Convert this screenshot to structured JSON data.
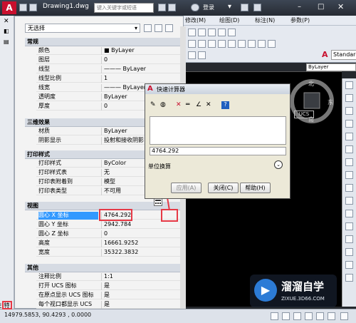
{
  "window": {
    "title": "Drawing1.dwg",
    "search_placeholder": "键入关键字或短语",
    "login": "登录"
  },
  "menu": [
    "修改(M)",
    "绘图(D)",
    "标注(N)",
    "参数(P)"
  ],
  "toolbar": {
    "style_value": "Standard",
    "layer_value": "ByLayer"
  },
  "viewcube": {
    "north": "北",
    "east": "东",
    "south": "南",
    "ucs": "UCS"
  },
  "statusbar": {
    "coords": "14979.5853,  90.4293  ,  0.0000"
  },
  "left_strip": {
    "label": "特性"
  },
  "palette": {
    "selection": "无选择",
    "sections": [
      {
        "title": "常规",
        "rows": [
          [
            "颜色",
            "■ ByLayer"
          ],
          [
            "图层",
            "0"
          ],
          [
            "线型",
            "——— ByLayer"
          ],
          [
            "线型比例",
            "1"
          ],
          [
            "线宽",
            "——— ByLayer"
          ],
          [
            "透明度",
            "ByLayer"
          ],
          [
            "厚度",
            "0"
          ]
        ]
      },
      {
        "title": "三维效果",
        "rows": [
          [
            "材质",
            "ByLayer"
          ],
          [
            "阴影显示",
            "投射和接收阴影"
          ]
        ]
      },
      {
        "title": "打印样式",
        "rows": [
          [
            "打印样式",
            "ByColor"
          ],
          [
            "打印样式表",
            "无"
          ],
          [
            "打印表附着到",
            "模型"
          ],
          [
            "打印表类型",
            "不可用"
          ]
        ]
      },
      {
        "title": "视图",
        "rows": [
          [
            "圆心 X 坐标",
            "4764.292"
          ],
          [
            "圆心 Y 坐标",
            "2942.784"
          ],
          [
            "圆心 Z 坐标",
            "0"
          ],
          [
            "高度",
            "16661.9252"
          ],
          [
            "宽度",
            "35322.3832"
          ]
        ]
      },
      {
        "title": "其他",
        "rows": [
          [
            "注释比例",
            "1:1"
          ],
          [
            "打开 UCS 图标",
            "是"
          ],
          [
            "在原点显示 UCS 图标",
            "是"
          ],
          [
            "每个视口都显示 UCS",
            "是"
          ]
        ]
      }
    ]
  },
  "calculator": {
    "title": "快速计算器",
    "input_value": "4764.292",
    "section_label": "单位换算",
    "apply": "应用(A)",
    "close": "关闭(C)",
    "help": "帮助(H)"
  },
  "watermark": {
    "title": "溜溜自学",
    "url": "ZIXUE.3D66.COM",
    "logo": "▶"
  },
  "colors": {
    "accent": "#c8102e",
    "highlight": "#e63946",
    "selection": "#3399ff"
  }
}
